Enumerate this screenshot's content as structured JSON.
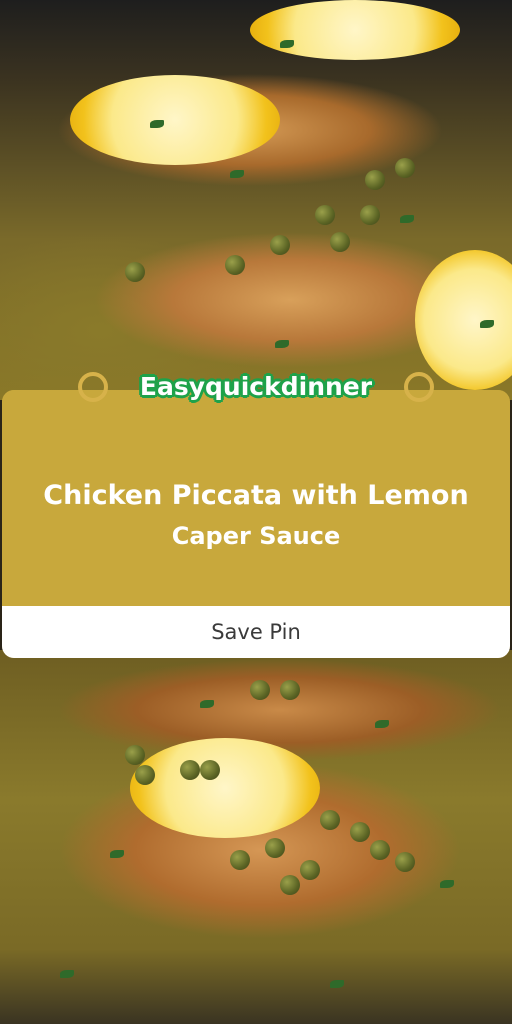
{
  "brand": {
    "name": "Easyquickdinner"
  },
  "recipe": {
    "title_line1": "Chicken Piccata with Lemon",
    "title_line2": "Caper Sauce"
  },
  "actions": {
    "save_label": "Save Pin"
  },
  "colors": {
    "card_background": "#c8a83c",
    "brand_outline": "#1ea24a",
    "save_bar": "#ffffff"
  }
}
